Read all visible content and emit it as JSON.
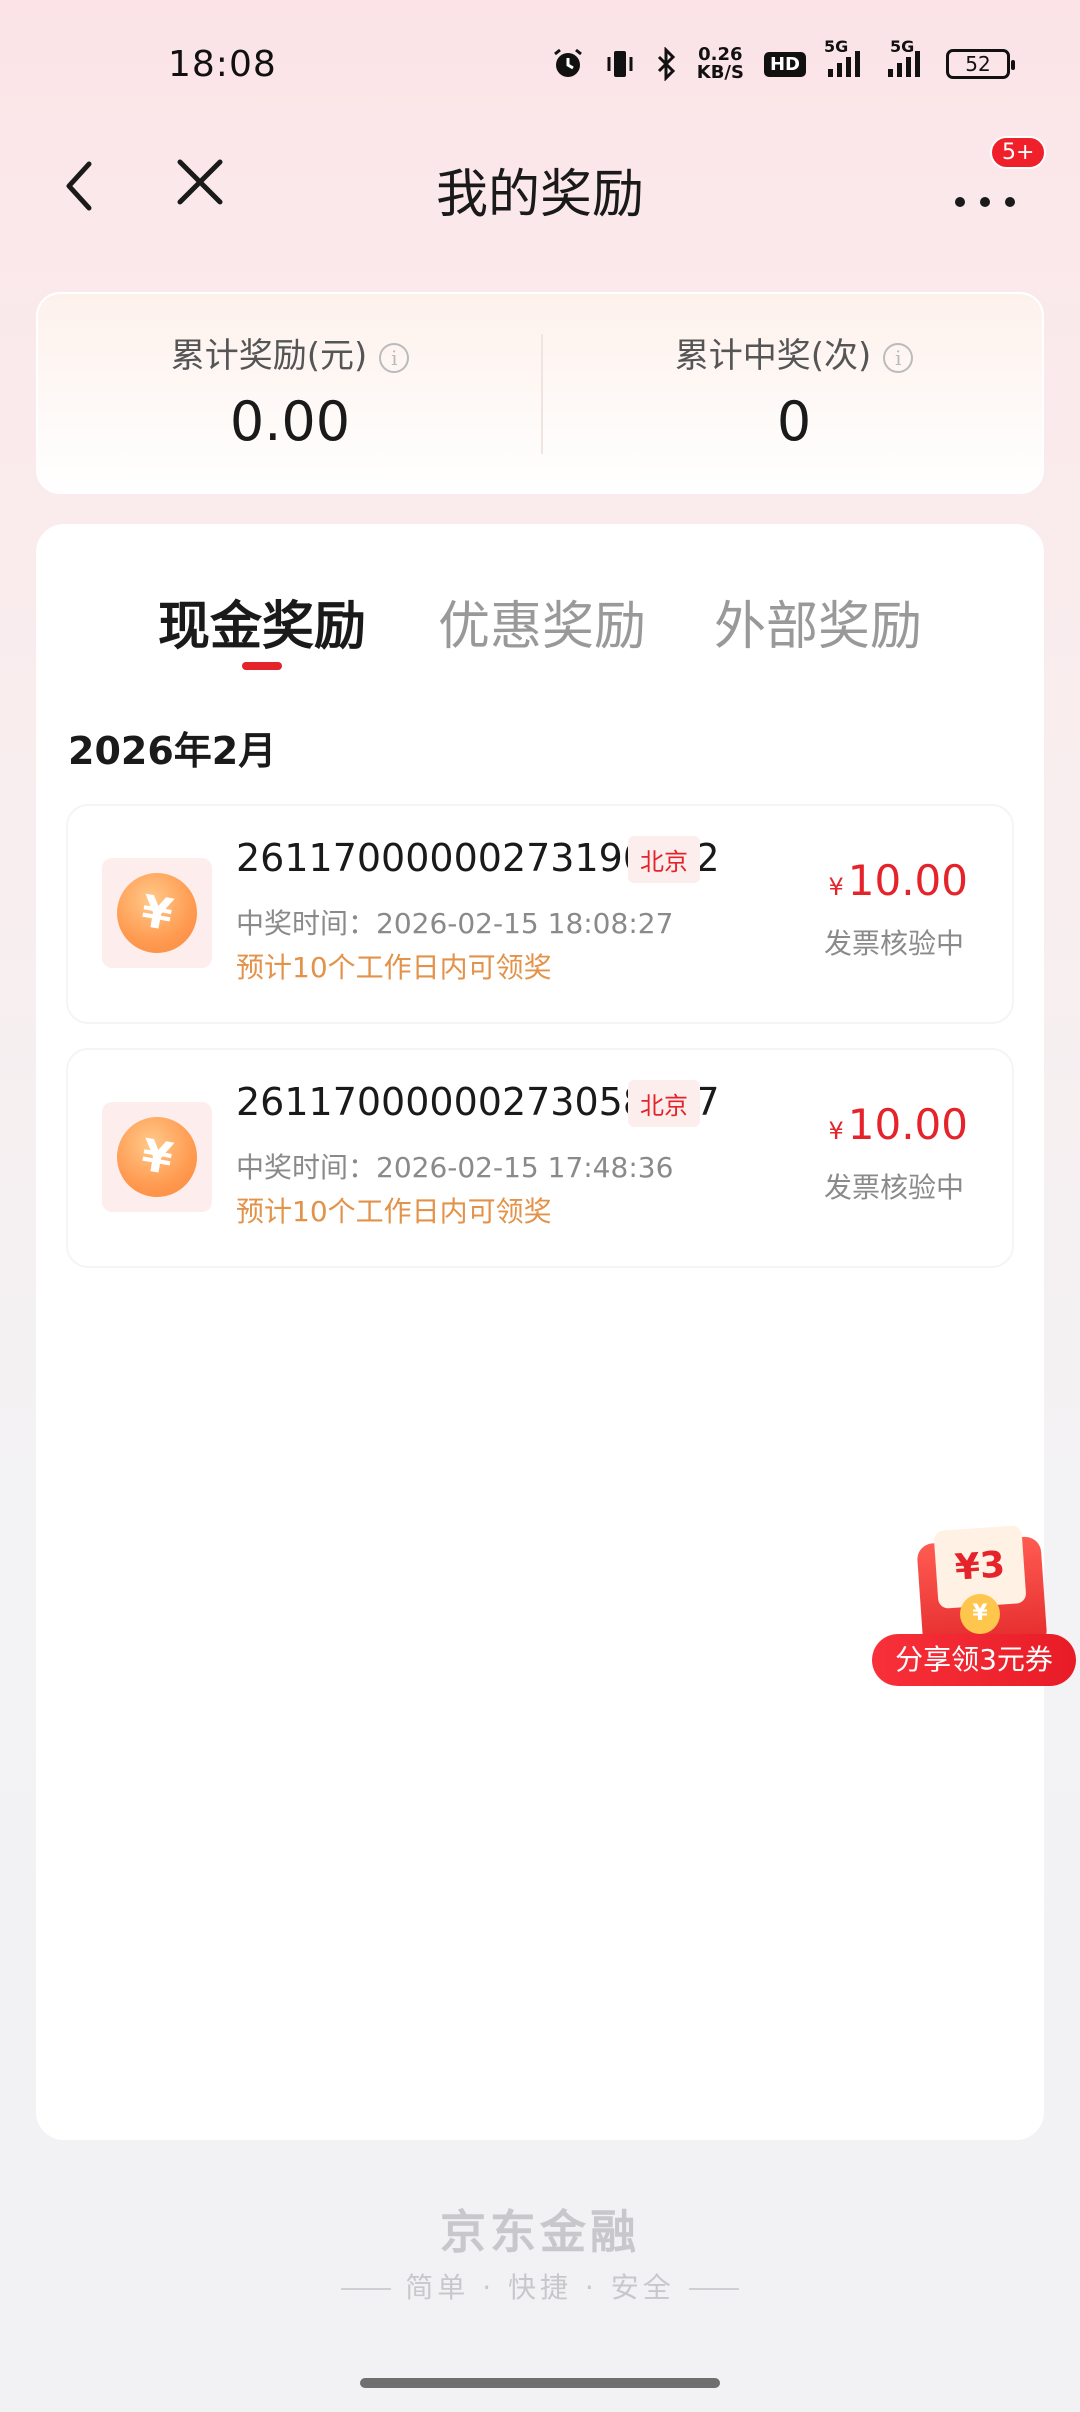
{
  "status_bar": {
    "time": "18:08",
    "net_speed_value": "0.26",
    "net_speed_unit": "KB/S",
    "hd": "HD",
    "signal_1": "5G",
    "signal_2": "5G",
    "battery": "52"
  },
  "nav": {
    "title": "我的奖励",
    "more_badge": "5+"
  },
  "stats": {
    "total_reward_label": "累计奖励(元)",
    "total_reward_value": "0.00",
    "total_wins_label": "累计中奖(次)",
    "total_wins_value": "0"
  },
  "tabs": [
    {
      "label": "现金奖励",
      "active": true
    },
    {
      "label": "优惠奖励",
      "active": false
    },
    {
      "label": "外部奖励",
      "active": false
    }
  ],
  "month": "2026年2月",
  "records": [
    {
      "id": "26117000000273190982",
      "city": "北京",
      "time": "中奖时间：2026-02-15 18:08:27",
      "note": "预计10个工作日内可领奖",
      "currency": "¥",
      "amount": "10.00",
      "status": "发票核验中"
    },
    {
      "id": "26117000000273058177",
      "city": "北京",
      "time": "中奖时间：2026-02-15 17:48:36",
      "note": "预计10个工作日内可领奖",
      "currency": "¥",
      "amount": "10.00",
      "status": "发票核验中"
    }
  ],
  "share": {
    "card_text": "¥3",
    "coin": "¥",
    "label": "分享领3元券"
  },
  "footer": {
    "brand": "京东金融",
    "slogan": "简单 · 快捷 · 安全"
  },
  "colors": {
    "accent_red": "#e4232a",
    "note_orange": "#e39349"
  }
}
